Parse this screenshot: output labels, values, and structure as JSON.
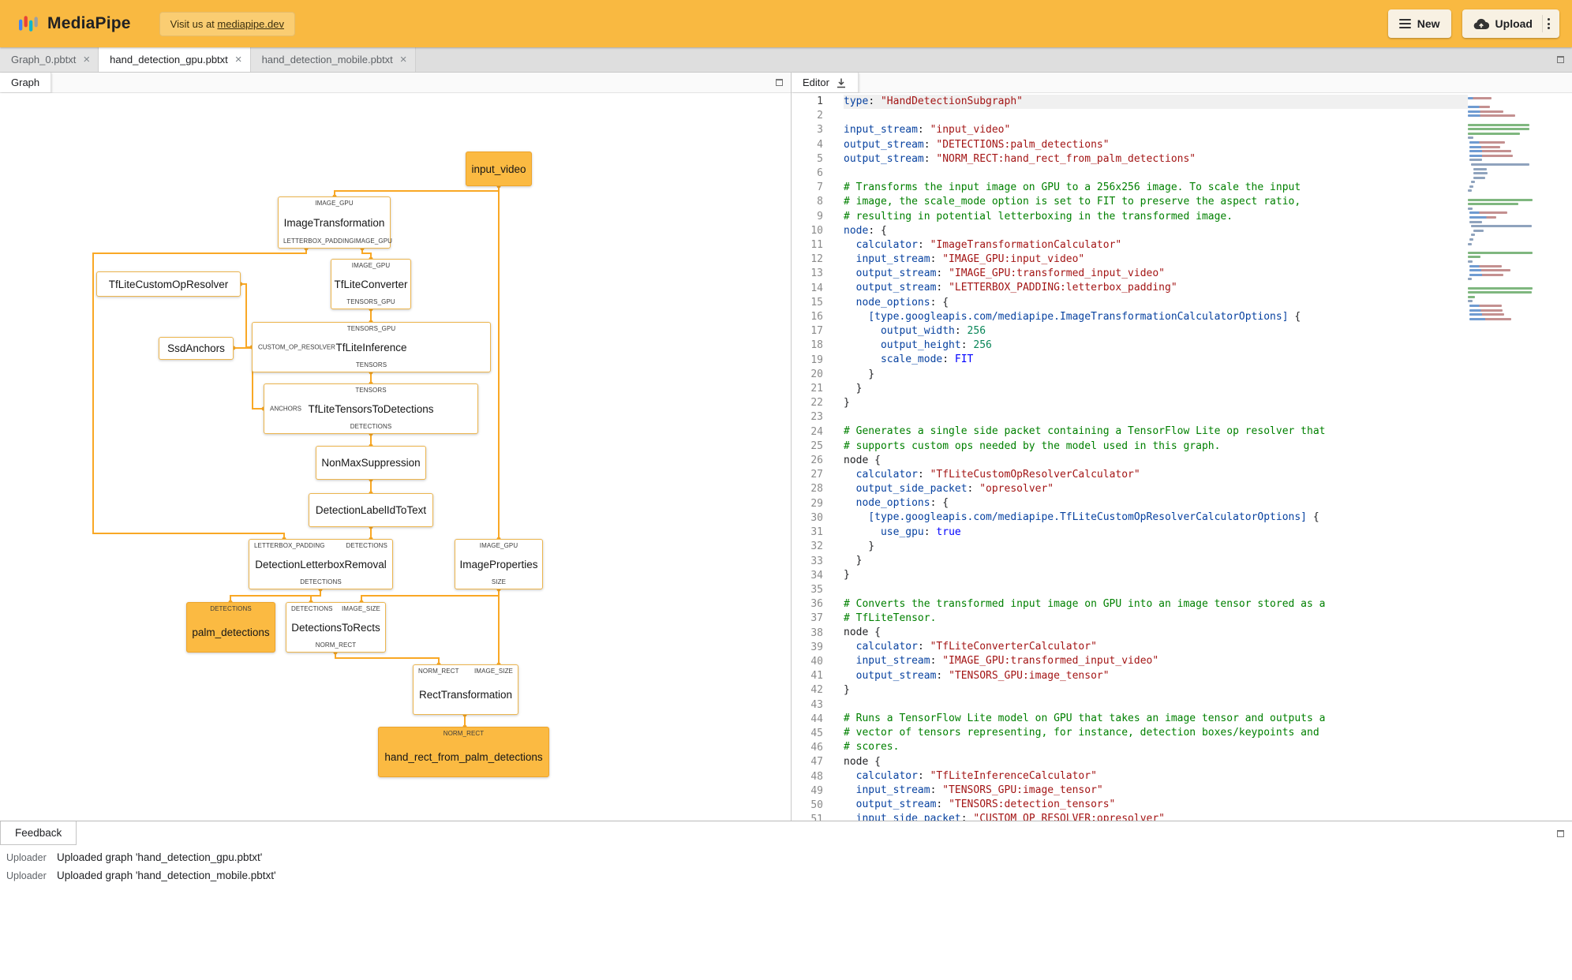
{
  "header": {
    "app_name": "MediaPipe",
    "visit_prefix": "Visit us at ",
    "visit_link": "mediapipe.dev",
    "new_label": "New",
    "upload_label": "Upload"
  },
  "file_tabs": [
    {
      "label": "Graph_0.pbtxt",
      "close": "×",
      "active": false
    },
    {
      "label": "hand_detection_gpu.pbtxt",
      "close": "×",
      "active": true
    },
    {
      "label": "hand_detection_mobile.pbtxt",
      "close": "×",
      "active": false
    }
  ],
  "graph_panel": {
    "tab_label": "Graph",
    "nodes": [
      {
        "label": "input_video",
        "type": "stream"
      },
      {
        "label": "ImageTransformation",
        "type": "calculator",
        "top_ports": [
          "IMAGE_GPU"
        ],
        "bottom_ports": [
          "LETTERBOX_PADDING",
          "IMAGE_GPU"
        ]
      },
      {
        "label": "TfLiteConverter",
        "type": "calculator",
        "top_ports": [
          "IMAGE_GPU"
        ],
        "bottom_ports": [
          "TENSORS_GPU"
        ]
      },
      {
        "label": "TfLiteCustomOpResolver",
        "type": "calculator"
      },
      {
        "label": "SsdAnchors",
        "type": "calculator"
      },
      {
        "label": "TfLiteInference",
        "type": "calculator",
        "top_ports": [
          "TENSORS_GPU"
        ],
        "left_port": "CUSTOM_OP_RESOLVER",
        "bottom_ports": [
          "TENSORS"
        ]
      },
      {
        "label": "TfLiteTensorsToDetections",
        "type": "calculator",
        "top_ports": [
          "TENSORS"
        ],
        "left_port": "ANCHORS",
        "bottom_ports": [
          "DETECTIONS"
        ]
      },
      {
        "label": "NonMaxSuppression",
        "type": "calculator"
      },
      {
        "label": "DetectionLabelIdToText",
        "type": "calculator"
      },
      {
        "label": "DetectionLetterboxRemoval",
        "type": "calculator",
        "top_ports": [
          "LETTERBOX_PADDING",
          "DETECTIONS"
        ],
        "bottom_ports": [
          "DETECTIONS"
        ]
      },
      {
        "label": "ImageProperties",
        "type": "calculator",
        "top_ports": [
          "IMAGE_GPU"
        ],
        "bottom_ports": [
          "SIZE"
        ]
      },
      {
        "label": "palm_detections",
        "type": "stream",
        "top_ports": [
          "DETECTIONS"
        ]
      },
      {
        "label": "DetectionsToRects",
        "type": "calculator",
        "top_ports": [
          "DETECTIONS",
          "IMAGE_SIZE"
        ],
        "bottom_ports": [
          "NORM_RECT"
        ]
      },
      {
        "label": "RectTransformation",
        "type": "calculator",
        "top_ports": [
          "NORM_RECT",
          "IMAGE_SIZE"
        ]
      },
      {
        "label": "hand_rect_from_palm_detections",
        "type": "stream",
        "top_ports": [
          "NORM_RECT"
        ]
      }
    ]
  },
  "editor_panel": {
    "tab_label": "Editor",
    "lines": [
      "type: \"HandDetectionSubgraph\"",
      "",
      "input_stream: \"input_video\"",
      "output_stream: \"DETECTIONS:palm_detections\"",
      "output_stream: \"NORM_RECT:hand_rect_from_palm_detections\"",
      "",
      "# Transforms the input image on GPU to a 256x256 image. To scale the input",
      "# image, the scale_mode option is set to FIT to preserve the aspect ratio,",
      "# resulting in potential letterboxing in the transformed image.",
      "node: {",
      "  calculator: \"ImageTransformationCalculator\"",
      "  input_stream: \"IMAGE_GPU:input_video\"",
      "  output_stream: \"IMAGE_GPU:transformed_input_video\"",
      "  output_stream: \"LETTERBOX_PADDING:letterbox_padding\"",
      "  node_options: {",
      "    [type.googleapis.com/mediapipe.ImageTransformationCalculatorOptions] {",
      "      output_width: 256",
      "      output_height: 256",
      "      scale_mode: FIT",
      "    }",
      "  }",
      "}",
      "",
      "# Generates a single side packet containing a TensorFlow Lite op resolver that",
      "# supports custom ops needed by the model used in this graph.",
      "node {",
      "  calculator: \"TfLiteCustomOpResolverCalculator\"",
      "  output_side_packet: \"opresolver\"",
      "  node_options: {",
      "    [type.googleapis.com/mediapipe.TfLiteCustomOpResolverCalculatorOptions] {",
      "      use_gpu: true",
      "    }",
      "  }",
      "}",
      "",
      "# Converts the transformed input image on GPU into an image tensor stored as a",
      "# TfLiteTensor.",
      "node {",
      "  calculator: \"TfLiteConverterCalculator\"",
      "  input_stream: \"IMAGE_GPU:transformed_input_video\"",
      "  output_stream: \"TENSORS_GPU:image_tensor\"",
      "}",
      "",
      "# Runs a TensorFlow Lite model on GPU that takes an image tensor and outputs a",
      "# vector of tensors representing, for instance, detection boxes/keypoints and",
      "# scores.",
      "node {",
      "  calculator: \"TfLiteInferenceCalculator\"",
      "  input_stream: \"TENSORS_GPU:image_tensor\"",
      "  output_stream: \"TENSORS:detection_tensors\"",
      "  input_side_packet: \"CUSTOM_OP_RESOLVER:opresolver\""
    ]
  },
  "feedback_panel": {
    "tab_label": "Feedback",
    "entries": [
      {
        "source": "Uploader",
        "message": "Uploaded graph 'hand_detection_gpu.pbtxt'"
      },
      {
        "source": "Uploader",
        "message": "Uploaded graph 'hand_detection_mobile.pbtxt'"
      }
    ]
  },
  "colors": {
    "header_bg": "#F9B941",
    "edge_amber": "#F9A825",
    "stream_node_bg": "#FBBA42",
    "syntax": {
      "key": "#0842a0",
      "string": "#a31515",
      "comment": "#008000",
      "number": "#098658",
      "keyword": "#0000ff"
    }
  }
}
